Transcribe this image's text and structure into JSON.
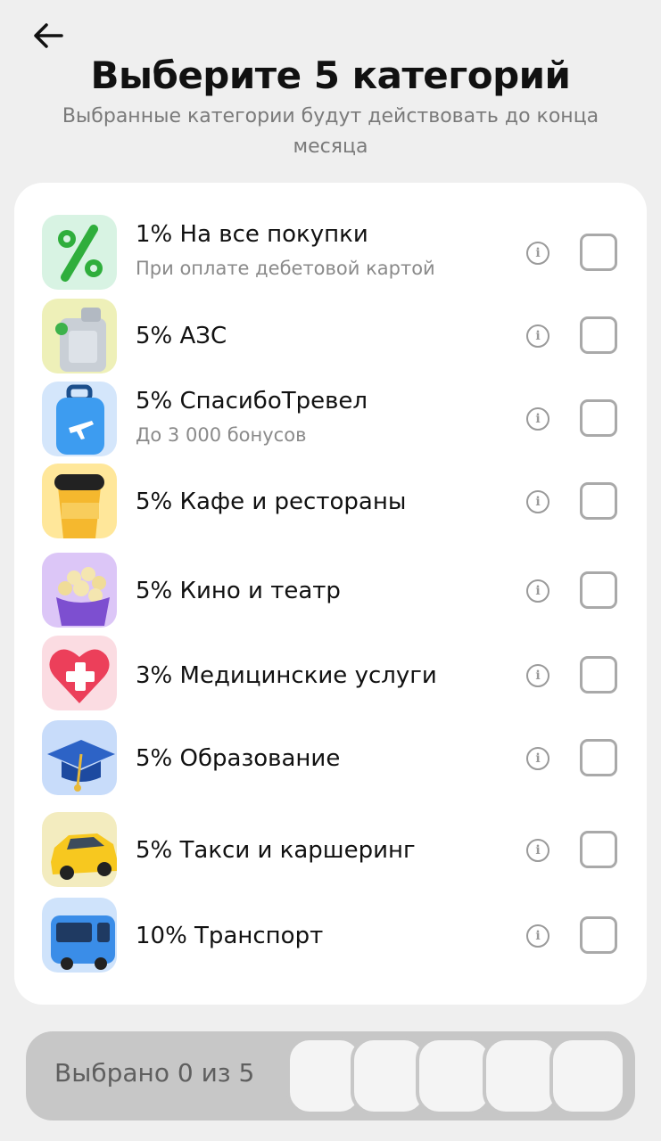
{
  "header": {
    "title": "Выберите 5 категорий",
    "subtitle": "Выбранные категории будут действовать до конца месяца"
  },
  "categories": [
    {
      "label": "1% На все покупки",
      "sub": "При оплате дебетовой картой",
      "icon": "percent-icon",
      "checked": false
    },
    {
      "label": "5% АЗС",
      "sub": "",
      "icon": "canister-icon",
      "checked": false
    },
    {
      "label": "5% СпасибоТревел",
      "sub": "До 3 000 бонусов",
      "icon": "suitcase-icon",
      "checked": false
    },
    {
      "label": "5% Кафе и рестораны",
      "sub": "",
      "icon": "coffee-cup-icon",
      "checked": false
    },
    {
      "label": "5% Кино и театр",
      "sub": "",
      "icon": "popcorn-icon",
      "checked": false
    },
    {
      "label": "3% Медицинские услуги",
      "sub": "",
      "icon": "medical-heart-icon",
      "checked": false
    },
    {
      "label": "5% Образование",
      "sub": "",
      "icon": "graduation-cap-icon",
      "checked": false
    },
    {
      "label": "5% Такси и каршеринг",
      "sub": "",
      "icon": "taxi-car-icon",
      "checked": false
    },
    {
      "label": "10% Транспорт",
      "sub": "",
      "icon": "bus-icon",
      "checked": false
    }
  ],
  "footer": {
    "selected_text": "Выбрано 0 из 5",
    "selected_count": 0,
    "max_count": 5
  },
  "colors": {
    "background": "#efefef",
    "card": "#ffffff",
    "footer_bar": "#c7c7c7",
    "secondary_text": "#8a8a8a"
  }
}
